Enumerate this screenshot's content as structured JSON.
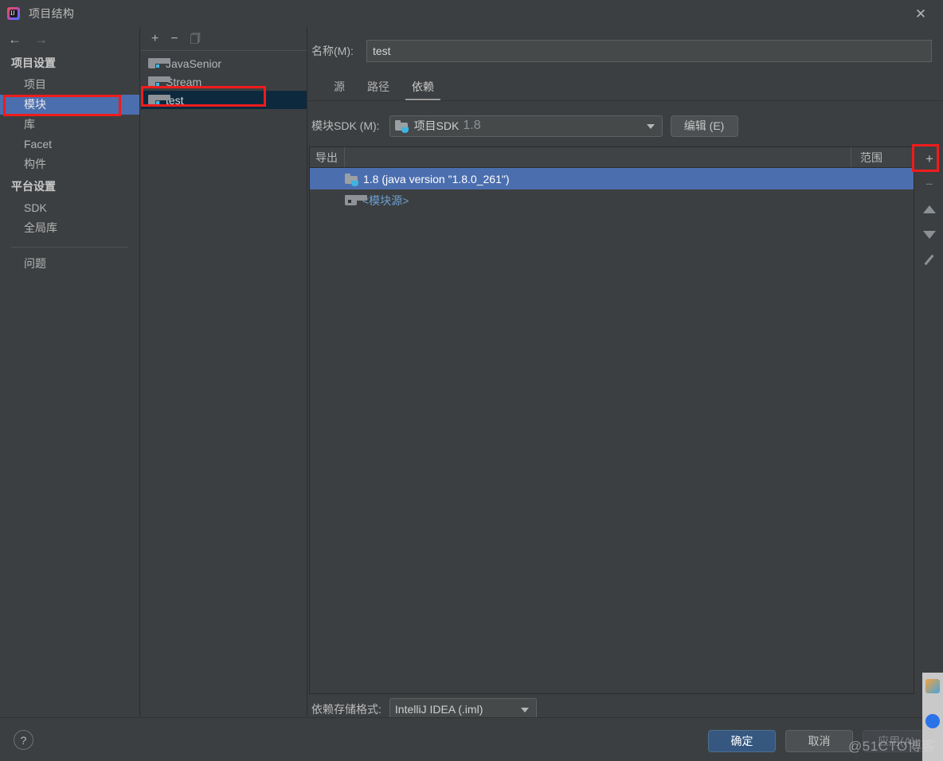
{
  "window": {
    "title": "项目结构",
    "logo_icon": "intellij-idea-logo",
    "close_icon": "close-icon"
  },
  "sidebar": {
    "nav": {
      "back_icon": "arrow-left-icon",
      "forward_icon": "arrow-right-icon"
    },
    "groups": [
      {
        "label": "项目设置",
        "items": [
          {
            "label": "项目",
            "selected": false
          },
          {
            "label": "模块",
            "selected": true
          },
          {
            "label": "库",
            "selected": false
          },
          {
            "label": "Facet",
            "selected": false
          },
          {
            "label": "构件",
            "selected": false
          }
        ]
      },
      {
        "label": "平台设置",
        "items": [
          {
            "label": "SDK",
            "selected": false
          },
          {
            "label": "全局库",
            "selected": false
          }
        ]
      }
    ],
    "problems_label": "问题"
  },
  "modules_panel": {
    "toolbar": {
      "add_icon": "plus-icon",
      "remove_icon": "minus-icon",
      "copy_icon": "copy-icon"
    },
    "items": [
      {
        "label": "JavaSenior",
        "selected": false,
        "icon": "module-folder-icon"
      },
      {
        "label": "Stream",
        "selected": false,
        "icon": "module-folder-icon"
      },
      {
        "label": "test",
        "selected": true,
        "icon": "module-folder-icon"
      }
    ]
  },
  "main": {
    "name_label": "名称(M):",
    "name_value": "test",
    "tabs": [
      {
        "label": "源",
        "active": false
      },
      {
        "label": "路径",
        "active": false
      },
      {
        "label": "依赖",
        "active": true
      }
    ],
    "sdk_label": "模块SDK (M):",
    "sdk_value": "项目SDK",
    "sdk_version": "1.8",
    "sdk_icon": "sdk-folder-icon",
    "edit_button": "编辑 (E)",
    "table": {
      "columns": {
        "export": "导出",
        "scope": "范围"
      },
      "rows": [
        {
          "label": "1.8 (java version \"1.8.0_261\")",
          "icon": "jdk-folder-icon",
          "selected": true,
          "is_link": false
        },
        {
          "label": "<模块源>",
          "icon": "module-source-icon",
          "selected": false,
          "is_link": true
        }
      ]
    },
    "vtoolbar": {
      "add_icon": "plus-icon",
      "remove_icon": "minus-icon",
      "move_up_icon": "arrow-up-icon",
      "move_down_icon": "arrow-down-icon",
      "edit_icon": "pencil-icon"
    },
    "storage_label": "依赖存储格式:",
    "storage_value": "IntelliJ IDEA (.iml)"
  },
  "footer": {
    "help_icon": "question-mark-icon",
    "ok_button": "确定",
    "cancel_button": "取消",
    "apply_button": "应用(A)"
  },
  "overlay": {
    "watermark": "@51CTO博客"
  },
  "colors": {
    "background": "#3c3f41",
    "selection_blue": "#4b6eaf",
    "tree_selection": "#0d293e",
    "annotation_red": "#ee1c1c",
    "ok_button": "#365880",
    "link_blue": "#6a9fd4"
  }
}
